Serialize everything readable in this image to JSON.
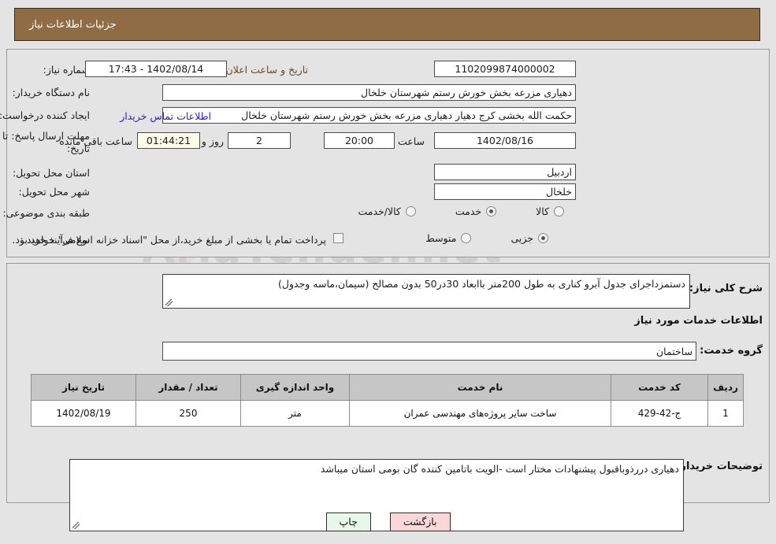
{
  "header": {
    "title": "جزئیات اطلاعات نیاز"
  },
  "form": {
    "need_number": {
      "label": "شماره نیاز:",
      "value": "1102099874000002"
    },
    "public_announce": {
      "label": "تاریخ و ساعت اعلان عمومی:",
      "value": "1402/08/14 - 17:43"
    },
    "buyer_org": {
      "label": "نام دستگاه خریدار:",
      "value": "دهیاری مزرعه بخش خورش رستم شهرستان خلخال"
    },
    "request_creator": {
      "label": "ایجاد کننده درخواست:",
      "value": "حکمت الله بخشی کرج دهیار دهیاری مزرعه بخش خورش رستم شهرستان خلخال",
      "contact_link": "اطلاعات تماس خریدار"
    },
    "deadline": {
      "label_line1": "مهلت ارسال پاسخ: تا",
      "label_line2": "تاریخ:",
      "date": "1402/08/16",
      "time_label": "ساعت",
      "time": "20:00",
      "days": "2",
      "days_label": "روز و",
      "countdown": "01:44:21",
      "remaining_label": "ساعت باقی مانده"
    },
    "province": {
      "label": "استان محل تحویل:",
      "value": "اردبیل"
    },
    "city": {
      "label": "شهر محل تحویل:",
      "value": "خلخال"
    },
    "category": {
      "label": "طبقه بندی موضوعی:",
      "options": [
        {
          "label": "کالا",
          "selected": false
        },
        {
          "label": "خدمت",
          "selected": true
        },
        {
          "label": "کالا/خدمت",
          "selected": false
        }
      ]
    },
    "purchase_type": {
      "label": "نوع فرآیند خرید :",
      "options": [
        {
          "label": "جزیی",
          "selected": true
        },
        {
          "label": "متوسط",
          "selected": false
        }
      ],
      "checkbox_checked": false,
      "checkbox_text": "پرداخت تمام یا بخشی از مبلغ خرید،از محل \"اسناد خزانه اسلامی\" خواهد بود."
    },
    "general_desc": {
      "label": "شرح کلی نیاز:",
      "value": "دستمزداجرای جدول آبرو کناری به طول 200متر باابعاد 30در50 بدون مصالح (سیمان،ماسه وجدول)"
    },
    "services_heading": "اطلاعات خدمات مورد نیاز",
    "service_group": {
      "label": "گروه خدمت:",
      "value": "ساختمان"
    },
    "buyer_notes": {
      "label": "توضیحات خریدار:",
      "value": "دهیاری دررذوباقبول پیشنهادات مختار است -الویت باتامین کننده گان بومی استان میباشد"
    }
  },
  "table": {
    "columns": [
      "ردیف",
      "کد خدمت",
      "نام خدمت",
      "واحد اندازه گیری",
      "تعداد / مقدار",
      "تاریخ نیاز"
    ],
    "rows": [
      {
        "row": "1",
        "service_code": "ج-42-429",
        "service_name": "ساخت سایر پروژه‌های مهندسی عمران",
        "unit": "متر",
        "quantity": "250",
        "need_date": "1402/08/19"
      }
    ]
  },
  "buttons": {
    "print": "چاپ",
    "back": "بازگشت"
  },
  "watermark": {
    "text": "AriaTender.net"
  },
  "colors": {
    "header_bg": "#8f6c43",
    "link": "#2020ee",
    "timer_bg": "#fbfbe6",
    "print_btn": "#e8f8e8",
    "back_btn": "#fbd7d8"
  }
}
